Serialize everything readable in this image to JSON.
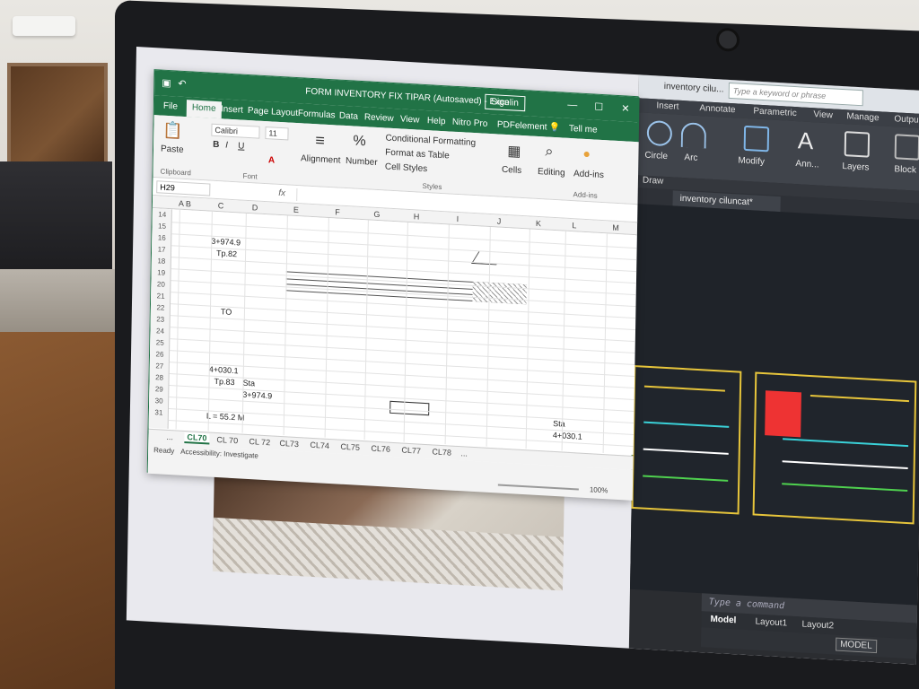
{
  "excel": {
    "title": "FORM INVENTORY FIX TIPAR (Autosaved)  -  Excel",
    "sign_in": "Sign in",
    "menu": [
      "File",
      "Home",
      "Insert",
      "Page Layout",
      "Formulas",
      "Data",
      "Review",
      "View",
      "Help",
      "Nitro Pro",
      "PDFelement"
    ],
    "tell_me": "Tell me",
    "font_name": "Calibri",
    "font_size": "11",
    "paste_label": "Paste",
    "clipboard_label": "Clipboard",
    "font_group": "Font",
    "alignment_label": "Alignment",
    "number_label": "Number",
    "conditional_formatting": "Conditional Formatting",
    "format_as_table": "Format as Table",
    "cell_styles": "Cell Styles",
    "styles_group": "Styles",
    "cells_label": "Cells",
    "editing_label": "Editing",
    "addins_label": "Add-ins",
    "addins_group": "Add-ins",
    "name_box": "H29",
    "fx": "fx",
    "columns": [
      "A",
      "B",
      "C",
      "D",
      "E",
      "F",
      "G",
      "H",
      "I",
      "J",
      "K",
      "L",
      "M"
    ],
    "rows": [
      "14",
      "15",
      "16",
      "17",
      "18",
      "19",
      "20",
      "21",
      "22",
      "23",
      "24",
      "25",
      "26",
      "27",
      "28",
      "29",
      "30",
      "31"
    ],
    "cells": {
      "c16": "3+974.9",
      "c17": "Tp.82",
      "c22": "TO",
      "c27": "4+030.1",
      "c28": "Tp.83",
      "d28": "Sta",
      "d29": "3+974.9",
      "l30": "Sta",
      "l31": "4+030.1",
      "c31": "L = 55.2 M"
    },
    "sheets": [
      "...",
      "CL70",
      "CL 70",
      "CL 72",
      "CL73",
      "CL74",
      "CL75",
      "CL76",
      "CL77",
      "CL78",
      "..."
    ],
    "status_ready": "Ready",
    "accessibility": "Accessibility: Investigate",
    "zoom": "100%"
  },
  "autocad": {
    "title": "inventory cilu...",
    "search_placeholder": "Type a keyword or phrase",
    "tabs": [
      "Insert",
      "Annotate",
      "Parametric",
      "View",
      "Manage",
      "Output"
    ],
    "tools": [
      "Circle",
      "Arc",
      "Modify",
      "Ann...",
      "Layers",
      "Block"
    ],
    "draw_label": "Draw",
    "doc_tab": "inventory ciluncat*",
    "command_placeholder": "Type a command",
    "layouts": [
      "Model",
      "Layout1",
      "Layout2"
    ],
    "model_label": "MODEL"
  },
  "colors": {
    "excel_green": "#217346",
    "autocad_dark": "#2b2d31",
    "sheet_border": "#e7c53b"
  }
}
